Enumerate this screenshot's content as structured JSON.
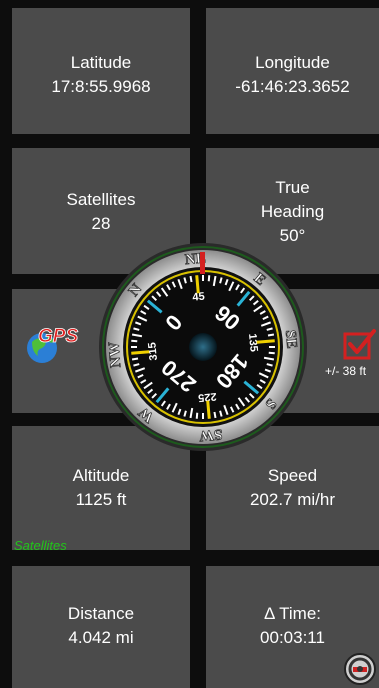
{
  "topbar": {
    "back_glyph": "◀◀◀"
  },
  "tiles": {
    "latitude": {
      "label": "Latitude",
      "value": "17:8:55.9968"
    },
    "longitude": {
      "label": "Longitude",
      "value": "-61:46:23.3652"
    },
    "satellites": {
      "label": "Satellites",
      "value": "28"
    },
    "true_heading": {
      "label_line1": "True",
      "label_line2": "Heading",
      "value": "50°"
    },
    "altitude": {
      "label": "Altitude",
      "value": "1125 ft"
    },
    "speed": {
      "label": "Speed",
      "value": "202.7 mi/hr"
    },
    "distance": {
      "label": "Distance",
      "value": "4.042 mi"
    },
    "delta_time": {
      "label": "Δ Time:",
      "value": "00:03:11"
    }
  },
  "satellites_tag": "Satellites",
  "gps_badge": "GPS",
  "accuracy": "+/- 38 ft",
  "compass": {
    "heading_deg": 50,
    "cardinals": {
      "N": "N",
      "NE": "NE",
      "E": "E",
      "SE": "SE",
      "S": "S",
      "SW": "SW",
      "W": "W",
      "NW": "NW"
    },
    "numbers": {
      "n0": "0",
      "n45": "45",
      "n90": "90",
      "n135": "135",
      "n180": "180",
      "n225": "225",
      "n270": "270",
      "n315": "315"
    }
  },
  "colors": {
    "tile": "#4b4b4b",
    "accent_green": "#22c41a",
    "heading_red": "#d42020",
    "tick_yellow": "#f0d000",
    "tick_cyan": "#2ab3d6"
  }
}
